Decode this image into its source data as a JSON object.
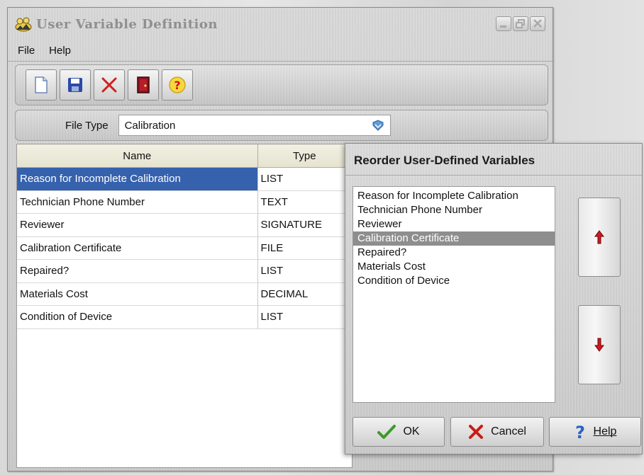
{
  "window": {
    "title": "User  Variable Definition",
    "icon": "user-variable-app-icon"
  },
  "menu": {
    "items": [
      "File",
      "Help"
    ]
  },
  "toolbar": {
    "buttons": [
      "new-document-icon",
      "save-icon",
      "delete-icon",
      "exit-door-icon",
      "help-icon"
    ]
  },
  "filetype": {
    "label": "File Type",
    "value": "Calibration"
  },
  "table": {
    "columns": [
      "Name",
      "Type"
    ],
    "rows": [
      {
        "name": "Reason for Incomplete Calibration",
        "type": "LIST",
        "selected": true
      },
      {
        "name": "Technician Phone Number",
        "type": "TEXT"
      },
      {
        "name": "Reviewer",
        "type": "SIGNATURE"
      },
      {
        "name": "Calibration Certificate",
        "type": "FILE"
      },
      {
        "name": "Repaired?",
        "type": "LIST"
      },
      {
        "name": "Materials Cost",
        "type": "DECIMAL"
      },
      {
        "name": "Condition of Device",
        "type": "LIST"
      }
    ]
  },
  "dialog": {
    "title": "Reorder User-Defined Variables",
    "items": [
      "Reason for Incomplete Calibration",
      "Technician Phone Number",
      "Reviewer",
      "Calibration Certificate",
      "Repaired?",
      "Materials Cost",
      "Condition of Device"
    ],
    "selected_index": 3,
    "ok_label": "OK",
    "cancel_label": "Cancel",
    "help_label": "Help"
  },
  "colors": {
    "selection": "#3561ad",
    "list_selection": "#8e8e8e",
    "arrow_red": "#c8141c"
  }
}
